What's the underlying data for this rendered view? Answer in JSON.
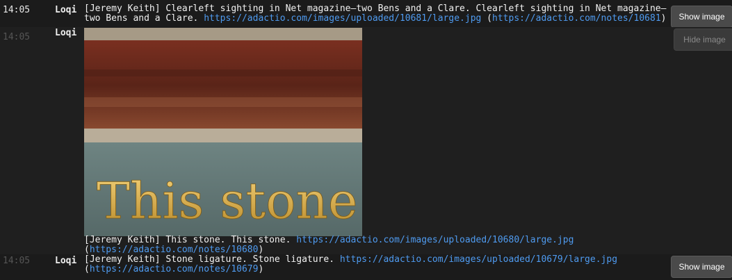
{
  "log": {
    "rows": [
      {
        "time": "14:05",
        "nick": "Loqi",
        "line1": "[Jeremy Keith] Clearleft sighting in Net magazine—two Bens and a Clare. Clearleft sighting in Net magazine—",
        "line2_text": "two Bens and a Clare. ",
        "image_link": "https://adactio.com/images/uploaded/10681/large.jpg",
        "note_open": " (",
        "note_link": "https://adactio.com/notes/10681",
        "note_close": ")",
        "button": "Show image"
      },
      {
        "time": "14:05",
        "nick": "Loqi",
        "image_text": "This stone",
        "text": "[Jeremy Keith] This stone. This stone. ",
        "image_link": "https://adactio.com/images/uploaded/10680/large.jpg",
        "note_open": "(",
        "note_link": "https://adactio.com/notes/10680",
        "note_close": ")",
        "button": "Hide image"
      },
      {
        "time": "14:05",
        "nick": "Loqi",
        "text": "[Jeremy Keith] Stone ligature. Stone ligature. ",
        "image_link": "https://adactio.com/images/uploaded/10679/large.jpg",
        "note_open": "(",
        "note_link": "https://adactio.com/notes/10679",
        "note_close": ")",
        "button": "Show image"
      }
    ]
  },
  "colors": {
    "background": "#1b1b1b",
    "link": "#4f9bf0",
    "text": "#f2f2f2"
  }
}
